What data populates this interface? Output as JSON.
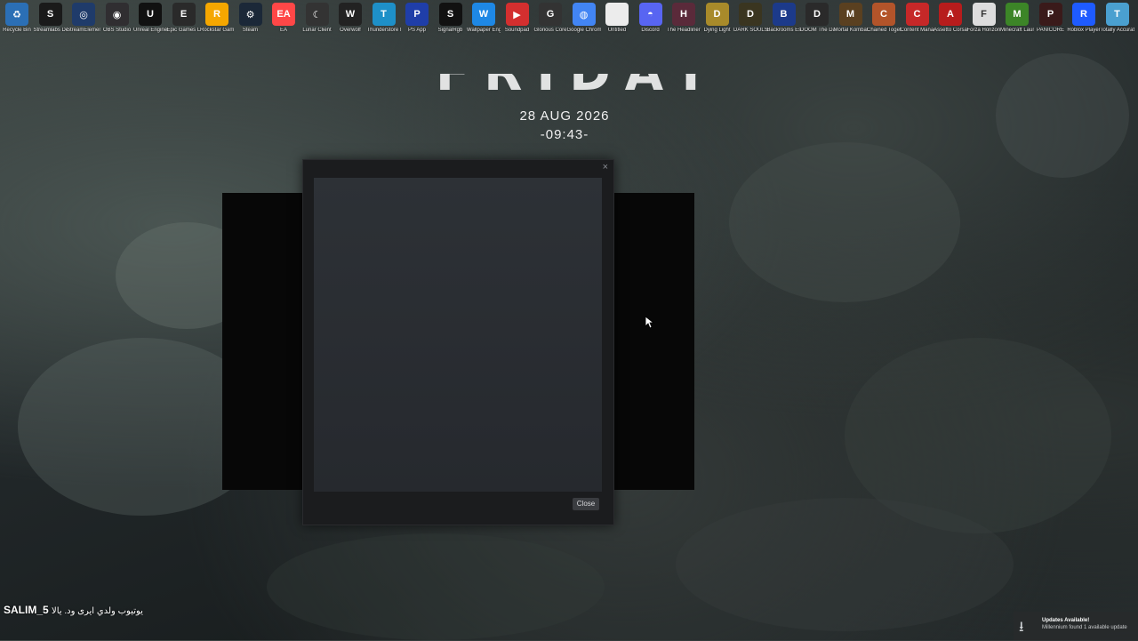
{
  "clock": {
    "day": "FRIDAY",
    "date": "28 AUG 2026",
    "time": "-09:43-"
  },
  "dialog": {
    "close_x": "×",
    "close_button": "Close"
  },
  "user": {
    "name": "SALIM_5",
    "status": "يوتيوب ولدي ایری ود. یالا"
  },
  "update_toast": {
    "title": "Updates Available!",
    "message": "Millennium found 1 available update"
  },
  "icons": [
    {
      "label": "Recycle Bin",
      "color": "#2b6fb5",
      "glyph": "♻"
    },
    {
      "label": "Streamlabs Desktop",
      "color": "#1a1a1a",
      "glyph": "S"
    },
    {
      "label": "StreamElements SE.Live",
      "color": "#1f3b6a",
      "glyph": "◎"
    },
    {
      "label": "OBS Studio",
      "color": "#302e31",
      "glyph": "◉"
    },
    {
      "label": "Unreal Engine",
      "color": "#111",
      "glyph": "U"
    },
    {
      "label": "Epic Games Launcher",
      "color": "#2a2a2a",
      "glyph": "E"
    },
    {
      "label": "Rockstar Games...",
      "color": "#f5a700",
      "glyph": "R"
    },
    {
      "label": "Steam",
      "color": "#1b2838",
      "glyph": "⚙"
    },
    {
      "label": "EA",
      "color": "#ff4747",
      "glyph": "EA"
    },
    {
      "label": "Lunar Client",
      "color": "#333",
      "glyph": "☾"
    },
    {
      "label": "Overwolf",
      "color": "#222",
      "glyph": "W"
    },
    {
      "label": "Thunderstore Mod Mana...",
      "color": "#1e90c8",
      "glyph": "T"
    },
    {
      "label": "PS App",
      "color": "#1f3ea8",
      "glyph": "P"
    },
    {
      "label": "SignalRgb",
      "color": "#111",
      "glyph": "S"
    },
    {
      "label": "Wallpaper Engine",
      "color": "#1e88e5",
      "glyph": "W"
    },
    {
      "label": "Soundpad",
      "color": "#d32f2f",
      "glyph": "▶"
    },
    {
      "label": "Glorious Core",
      "color": "#333",
      "glyph": "G"
    },
    {
      "label": "Google Chrome",
      "color": "#4285f4",
      "glyph": "◍"
    },
    {
      "label": "Untitled",
      "color": "#ececec",
      "glyph": ""
    },
    {
      "label": "Discord",
      "color": "#5865f2",
      "glyph": "◓"
    },
    {
      "label": "The Headliners",
      "color": "#5a2a3a",
      "glyph": "H"
    },
    {
      "label": "Dying Light",
      "color": "#a88a2a",
      "glyph": "D"
    },
    {
      "label": "DARK SOULS™ III",
      "color": "#3a3520",
      "glyph": "D"
    },
    {
      "label": "Backrooms Escape T...",
      "color": "#1c3a8a",
      "glyph": "B"
    },
    {
      "label": "DOOM The Dark Ages",
      "color": "#2a2a2a",
      "glyph": "D"
    },
    {
      "label": "Mortal Kombat™ 11",
      "color": "#5a4020",
      "glyph": "M"
    },
    {
      "label": "Chained Together",
      "color": "#b3542a",
      "glyph": "C"
    },
    {
      "label": "Content Manager",
      "color": "#c62828",
      "glyph": "C"
    },
    {
      "label": "Assetto Corsa",
      "color": "#b71c1c",
      "glyph": "A"
    },
    {
      "label": "Forza Horizon 6",
      "color": "#ddd",
      "glyph": "F"
    },
    {
      "label": "Minecraft Launcher",
      "color": "#3c8527",
      "glyph": "M"
    },
    {
      "label": "PANICORE",
      "color": "#3a1a1a",
      "glyph": "P"
    },
    {
      "label": "Roblox Player",
      "color": "#1e5bff",
      "glyph": "R"
    },
    {
      "label": "Totally Accurat...",
      "color": "#4aa0d0",
      "glyph": "T"
    }
  ]
}
